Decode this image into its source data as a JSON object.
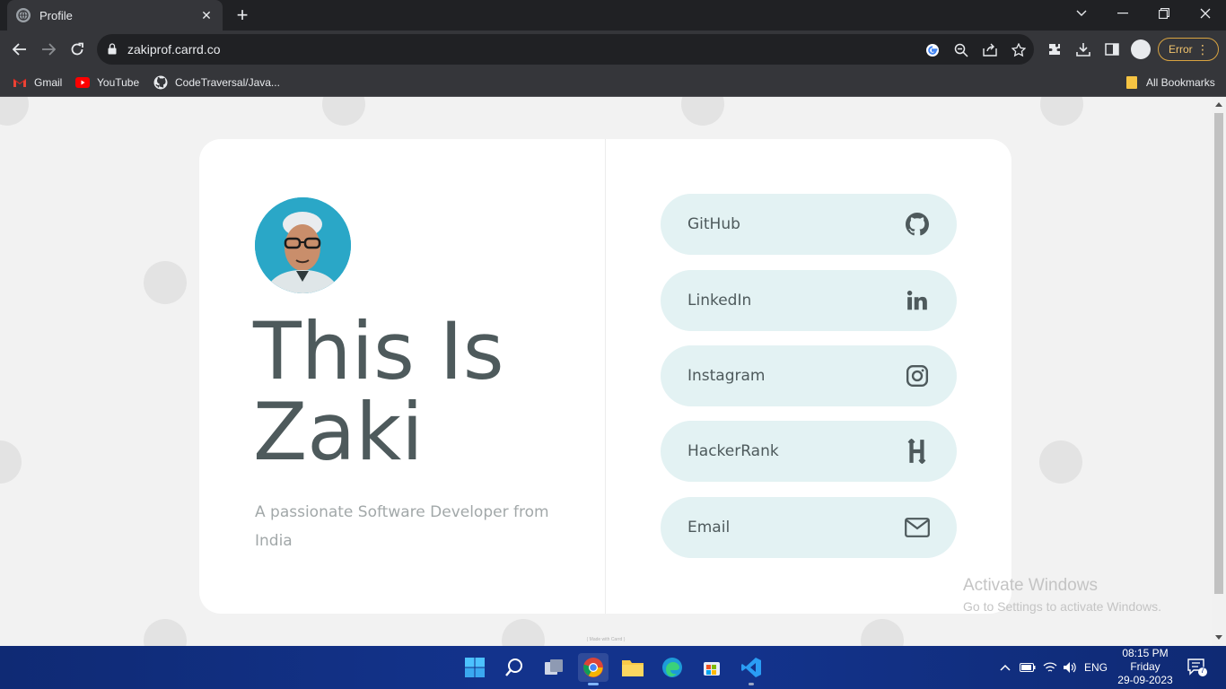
{
  "browser": {
    "tab_title": "Profile",
    "url": "zakiprof.carrd.co",
    "error_label": "Error",
    "bookmarks": [
      {
        "label": "Gmail",
        "icon": "gmail-icon"
      },
      {
        "label": "YouTube",
        "icon": "youtube-icon"
      },
      {
        "label": "CodeTraversal/Java...",
        "icon": "github-icon"
      }
    ],
    "all_bookmarks_label": "All Bookmarks"
  },
  "profile": {
    "headline_line1": "This Is",
    "headline_line2": "Zaki",
    "tagline": "A passionate Software Developer from India"
  },
  "links": [
    {
      "label": "GitHub",
      "icon": "github-icon"
    },
    {
      "label": "LinkedIn",
      "icon": "linkedin-icon"
    },
    {
      "label": "Instagram",
      "icon": "instagram-icon"
    },
    {
      "label": "HackerRank",
      "icon": "hackerrank-icon"
    },
    {
      "label": "Email",
      "icon": "envelope-icon"
    }
  ],
  "footer": {
    "made_with": "( Made with Carrd )"
  },
  "watermark": {
    "title": "Activate Windows",
    "subtitle": "Go to Settings to activate Windows."
  },
  "taskbar": {
    "language": "ENG",
    "time": "08:15 PM",
    "day": "Friday",
    "date": "29-09-2023",
    "notification_count": "7"
  },
  "colors": {
    "card_bg": "#ffffff",
    "button_bg": "#e3f2f3",
    "headline": "#4e5a5c",
    "tagline": "#a2a8a9"
  }
}
